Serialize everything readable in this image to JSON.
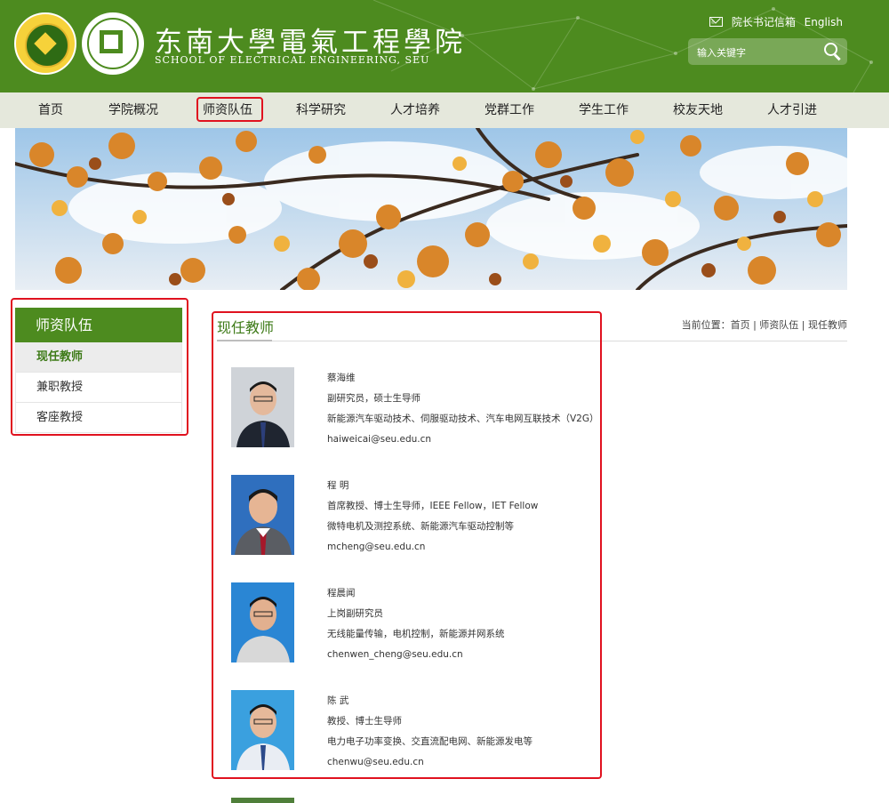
{
  "header": {
    "title_cn": "东南大學電氣工程學院",
    "title_en": "SCHOOL OF ELECTRICAL ENGINEERING, SEU",
    "mailbox_label": "院长书记信箱",
    "english_label": "English",
    "search_placeholder": "输入关键字"
  },
  "nav": {
    "items": [
      {
        "label": "首页"
      },
      {
        "label": "学院概况"
      },
      {
        "label": "师资队伍"
      },
      {
        "label": "科学研究"
      },
      {
        "label": "人才培养"
      },
      {
        "label": "党群工作"
      },
      {
        "label": "学生工作"
      },
      {
        "label": "校友天地"
      },
      {
        "label": "人才引进"
      }
    ],
    "active_index": 2
  },
  "sidebar": {
    "heading": "师资队伍",
    "items": [
      {
        "label": "现任教师",
        "active": true
      },
      {
        "label": "兼职教授",
        "active": false
      },
      {
        "label": "客座教授",
        "active": false
      }
    ]
  },
  "main": {
    "title": "现任教师",
    "breadcrumb": "当前位置：首页 | 师资队伍 | 现任教师"
  },
  "faculty": [
    {
      "name": "蔡海维",
      "title": "副研究员，硕士生导师",
      "research": "新能源汽车驱动技术、伺服驱动技术、汽车电网互联技术（V2G）",
      "email": "haiweicai@seu.edu.cn",
      "bg": "#cfd3d8"
    },
    {
      "name": "程 明",
      "title": "首席教授、博士生导师，IEEE Fellow，IET Fellow",
      "research": "微特电机及测控系统、新能源汽车驱动控制等",
      "email": "mcheng@seu.edu.cn",
      "bg": "#2f6fbe"
    },
    {
      "name": "程晨闻",
      "title": "上岗副研究员",
      "research": "无线能量传输，电机控制，新能源并网系统",
      "email": "chenwen_cheng@seu.edu.cn",
      "bg": "#2a86d4"
    },
    {
      "name": "陈 武",
      "title": "教授、博士生导师",
      "research": "电力电子功率变换、交直流配电网、新能源发电等",
      "email": "chenwu@seu.edu.cn",
      "bg": "#3aa0df"
    }
  ],
  "colors": {
    "brand_green": "#4d8b1f",
    "highlight_red": "#e0121f"
  }
}
